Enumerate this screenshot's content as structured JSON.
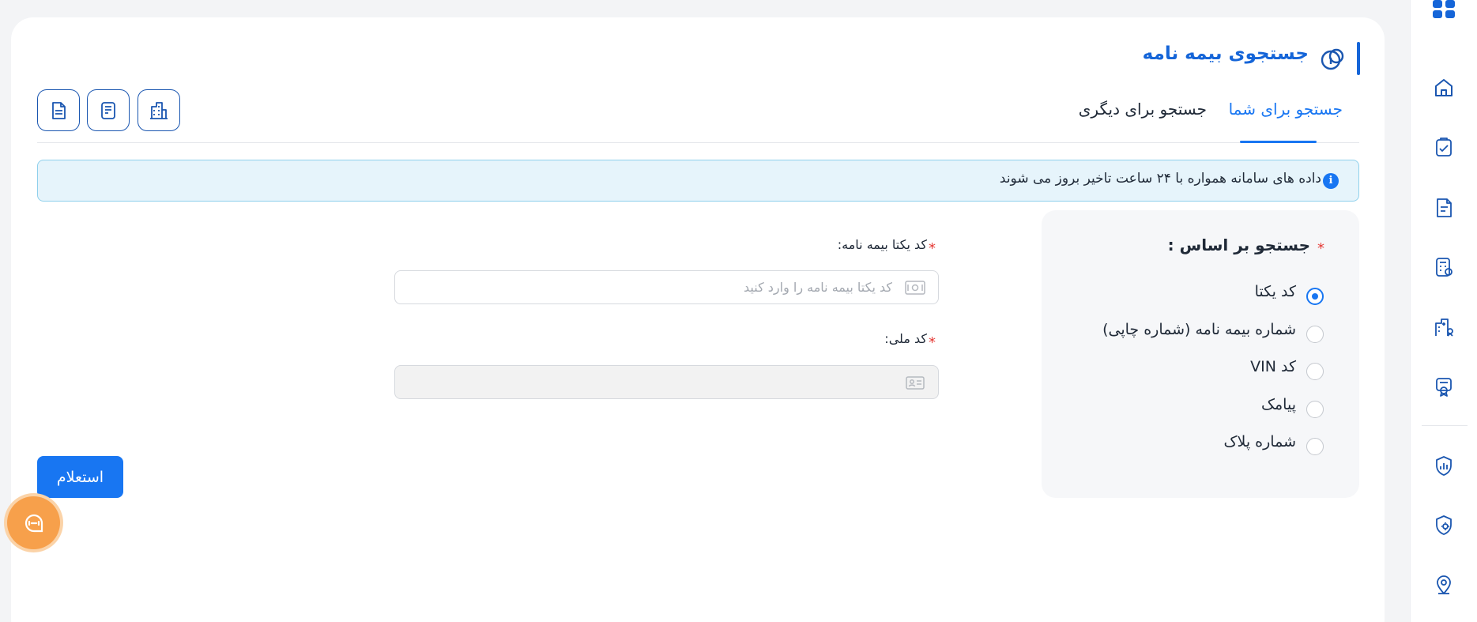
{
  "header": {
    "title": "جستجوی بیمه نامه",
    "tabs": [
      {
        "label": "جستجو برای شما",
        "active": true
      },
      {
        "label": "جستجو برای دیگری",
        "active": false
      }
    ],
    "tool_buttons": [
      "building-icon",
      "report-icon",
      "document-icon"
    ]
  },
  "info": {
    "icon": "i",
    "text": "داده های سامانه همواره با ۲۴ ساعت تاخیر بروز می شوند"
  },
  "search_by": {
    "required_mark": "*",
    "title": "جستجو بر اساس :",
    "options": [
      {
        "label": "کد یکتا",
        "selected": true
      },
      {
        "label": "شماره بیمه نامه (شماره چاپی)",
        "selected": false
      },
      {
        "label": "کد VIN",
        "selected": false
      },
      {
        "label": "پیامک",
        "selected": false
      },
      {
        "label": "شماره پلاک",
        "selected": false
      }
    ]
  },
  "form": {
    "unique_code": {
      "required_mark": "*",
      "label": "کد یکتا بیمه نامه:",
      "placeholder": "کد یکتا بیمه نامه را وارد کنید",
      "value": ""
    },
    "national_code": {
      "required_mark": "*",
      "label": "کد ملی:",
      "placeholder": "",
      "value": "",
      "disabled": true
    },
    "submit_label": "استعلام"
  },
  "sidebar": {
    "items": [
      "home-icon",
      "clipboard-check-icon",
      "document-edit-icon",
      "calculator-icon",
      "hospital-icon",
      "certificate-icon",
      "shield-chart-icon",
      "shield-gear-icon",
      "location-pin-icon"
    ]
  },
  "colors": {
    "primary": "#1876f2",
    "title_blue": "#1565d8",
    "required": "#e53935",
    "info_bg": "#e6f4fb",
    "chat": "#f7a04b"
  }
}
